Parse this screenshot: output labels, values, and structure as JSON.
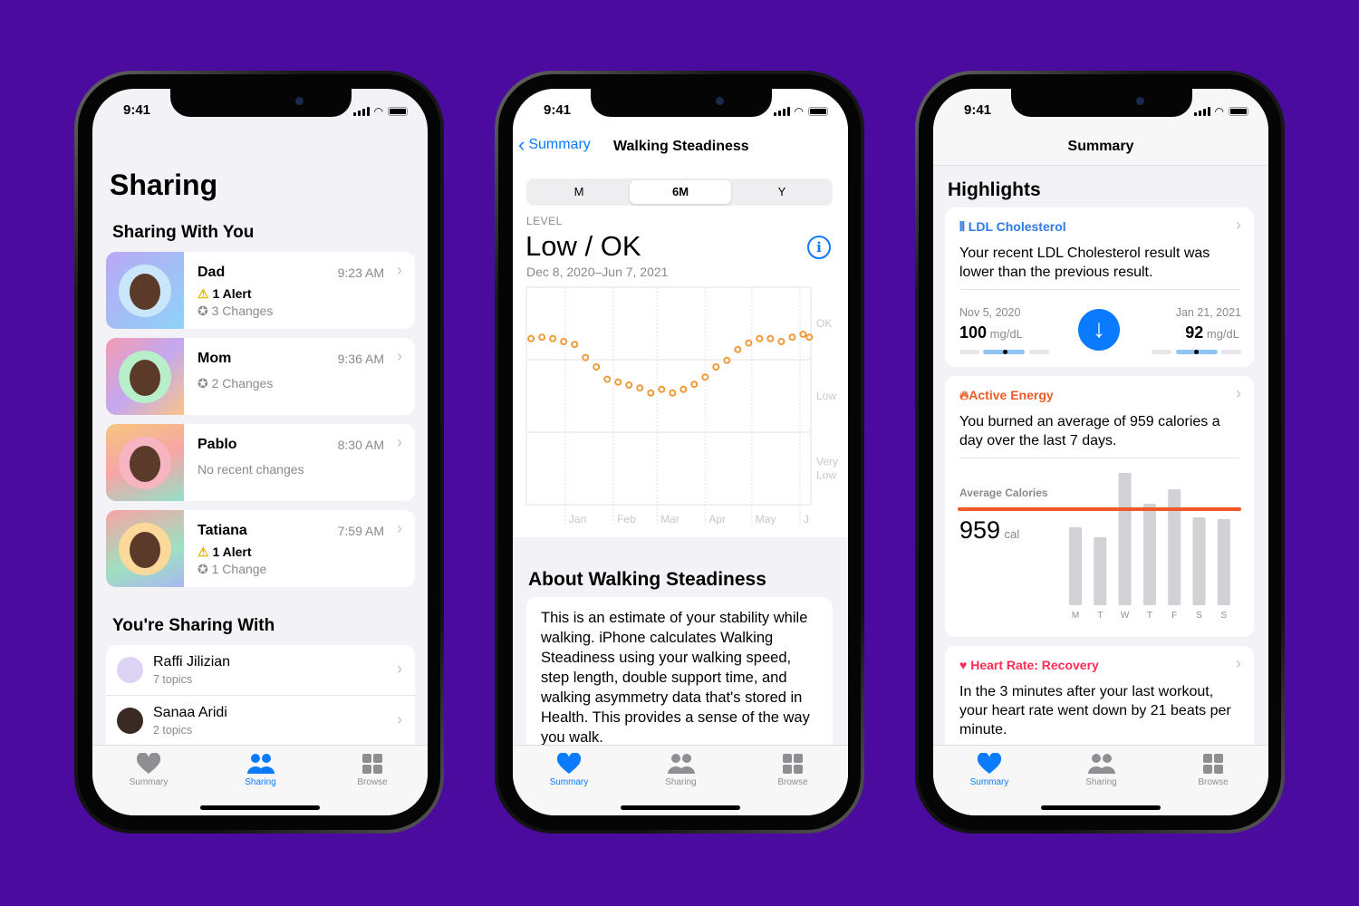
{
  "status": {
    "time": "9:41"
  },
  "colors": {
    "background": "#4a0b9e",
    "accent": "#0a7aff",
    "orange": "#f09a37",
    "energy": "#f05a28",
    "heart": "#ff2d55",
    "alert": "#ffd60a"
  },
  "tabs": [
    {
      "label": "Summary",
      "icon": "heart-icon"
    },
    {
      "label": "Sharing",
      "icon": "people-icon"
    },
    {
      "label": "Browse",
      "icon": "grid-icon"
    }
  ],
  "sharing": {
    "title": "Sharing",
    "with_you_header": "Sharing With You",
    "people": [
      {
        "name": "Dad",
        "time": "9:23 AM",
        "alert": "1 Alert",
        "changes": "3 Changes"
      },
      {
        "name": "Mom",
        "time": "9:36 AM",
        "alert": null,
        "changes": "2 Changes"
      },
      {
        "name": "Pablo",
        "time": "8:30 AM",
        "alert": null,
        "changes": "No recent changes"
      },
      {
        "name": "Tatiana",
        "time": "7:59 AM",
        "alert": "1 Alert",
        "changes": "1 Change"
      }
    ],
    "sharing_with_header": "You're Sharing With",
    "contacts": [
      {
        "name": "Raffi Jilizian",
        "topics": "7 topics"
      },
      {
        "name": "Sanaa Aridi",
        "topics": "2 topics"
      }
    ],
    "active_tab": "Sharing"
  },
  "steadiness": {
    "back_label": "Summary",
    "title": "Walking Steadiness",
    "segments": [
      "M",
      "6M",
      "Y"
    ],
    "selected_segment": "6M",
    "level_label": "LEVEL",
    "level_value": "Low / OK",
    "date_range": "Dec 8, 2020–Jun 7, 2021",
    "about_title": "About Walking Steadiness",
    "about_text": "This is an estimate of your stability while walking. iPhone calculates Walking Steadiness using your walking speed, step length, double support time, and walking asymmetry data that's stored in Health. This provides a sense of the way you walk.",
    "active_tab": "Summary"
  },
  "chart_data": [
    {
      "type": "scatter",
      "title": "",
      "xlabel": "",
      "ylabel": "",
      "x_tick_labels": [
        "Jan",
        "Feb",
        "Mar",
        "Apr",
        "May",
        "J"
      ],
      "y_bands": [
        "Very Low",
        "Low",
        "OK"
      ],
      "ylim": [
        0,
        3
      ],
      "grid": true,
      "x": [
        "2020-12-10",
        "2020-12-17",
        "2020-12-24",
        "2020-12-31",
        "2021-01-07",
        "2021-01-14",
        "2021-01-21",
        "2021-01-28",
        "2021-02-04",
        "2021-02-11",
        "2021-02-18",
        "2021-02-25",
        "2021-03-04",
        "2021-03-11",
        "2021-03-18",
        "2021-03-25",
        "2021-04-01",
        "2021-04-08",
        "2021-04-15",
        "2021-04-22",
        "2021-04-29",
        "2021-05-06",
        "2021-05-13",
        "2021-05-20",
        "2021-05-27",
        "2021-06-03",
        "2021-06-07"
      ],
      "values": [
        2.29,
        2.31,
        2.29,
        2.25,
        2.21,
        2.03,
        1.9,
        1.73,
        1.69,
        1.65,
        1.61,
        1.54,
        1.59,
        1.54,
        1.59,
        1.66,
        1.76,
        1.9,
        1.99,
        2.14,
        2.23,
        2.29,
        2.29,
        2.25,
        2.31,
        2.35,
        2.31
      ],
      "color": "#f09a37"
    },
    {
      "type": "bar",
      "title": "Average Calories",
      "categories": [
        "M",
        "T",
        "W",
        "T",
        "F",
        "S",
        "S"
      ],
      "values": [
        778,
        679,
        1321,
        1013,
        1158,
        878,
        860
      ],
      "average": 959,
      "average_unit": "cal",
      "ylabel": "",
      "xlabel": ""
    }
  ],
  "summary": {
    "header": "Summary",
    "highlights_title": "Highlights",
    "ldl": {
      "title": "LDL Cholesterol",
      "text": "Your recent LDL Cholesterol result was lower than the previous result.",
      "prev": {
        "date": "Nov 5, 2020",
        "value": "100",
        "unit": "mg/dL"
      },
      "curr": {
        "date": "Jan 21, 2021",
        "value": "92",
        "unit": "mg/dL"
      }
    },
    "energy": {
      "title": "Active Energy",
      "text": "You burned an average of 959 calories a day over the last 7 days.",
      "avg_label": "Average Calories",
      "avg_value": "959",
      "avg_unit": "cal"
    },
    "heart": {
      "title": "Heart Rate: Recovery",
      "text": "In the 3 minutes after your last workout, your heart rate went down by 21 beats per minute."
    },
    "active_tab": "Summary"
  }
}
